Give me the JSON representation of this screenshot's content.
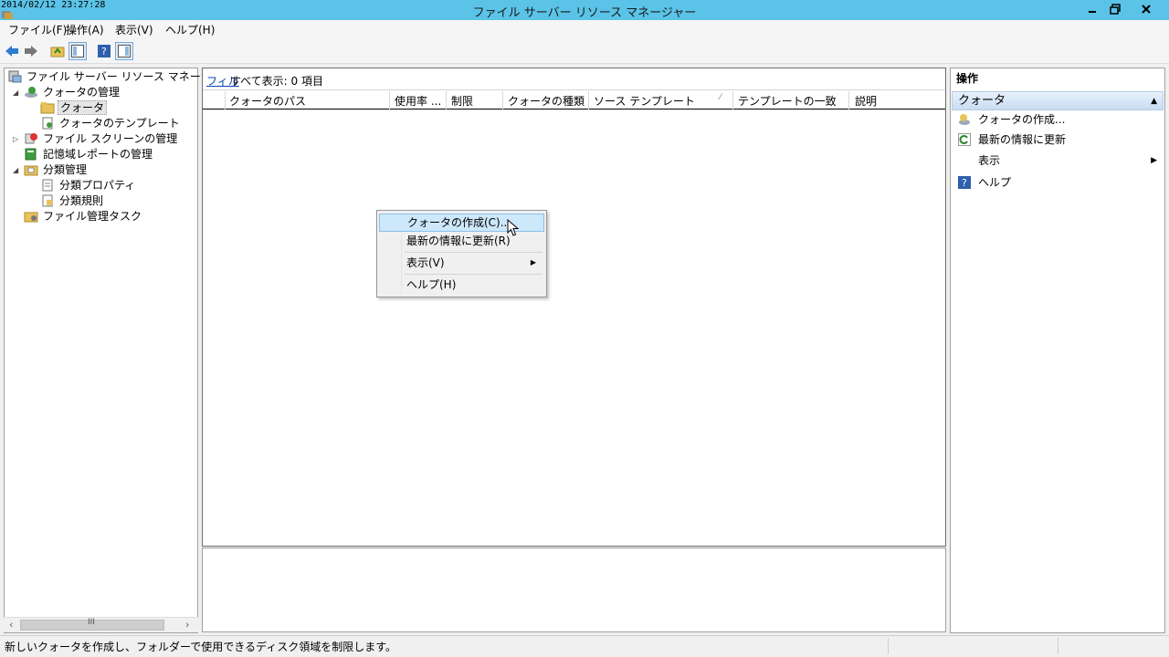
{
  "window": {
    "title": "ファイル サーバー リソース マネージャー",
    "timestamp": "2014/02/12 23:27:28"
  },
  "menubar": [
    "ファイル(F)",
    "操作(A)",
    "表示(V)",
    "ヘルプ(H)"
  ],
  "tree": {
    "root": "ファイル サーバー リソース マネージャー (ロ-",
    "quota_mgmt": "クォータの管理",
    "quota": "クォータ",
    "quota_templates": "クォータのテンプレート",
    "file_screen_mgmt": "ファイル スクリーンの管理",
    "storage_reports": "記憶域レポートの管理",
    "classification": "分類管理",
    "class_props": "分類プロパティ",
    "class_rules": "分類規則",
    "file_tasks": "ファイル管理タスク"
  },
  "center": {
    "filter_link": "フィル",
    "filter_text": "すべて表示: 0 項目",
    "columns": [
      "クォータのパス",
      "使用率 ...",
      "制限",
      "クォータの種類",
      "ソース テンプレート",
      "テンプレートの一致",
      "説明"
    ]
  },
  "context_menu": {
    "create": "クォータの作成(C)...",
    "refresh": "最新の情報に更新(R)",
    "view": "表示(V)",
    "help": "ヘルプ(H)"
  },
  "actions": {
    "header": "操作",
    "section": "クォータ",
    "items": [
      "クォータの作成...",
      "最新の情報に更新",
      "表示",
      "ヘルプ"
    ]
  },
  "status": "新しいクォータを作成し、フォルダーで使用できるディスク領域を制限します。"
}
